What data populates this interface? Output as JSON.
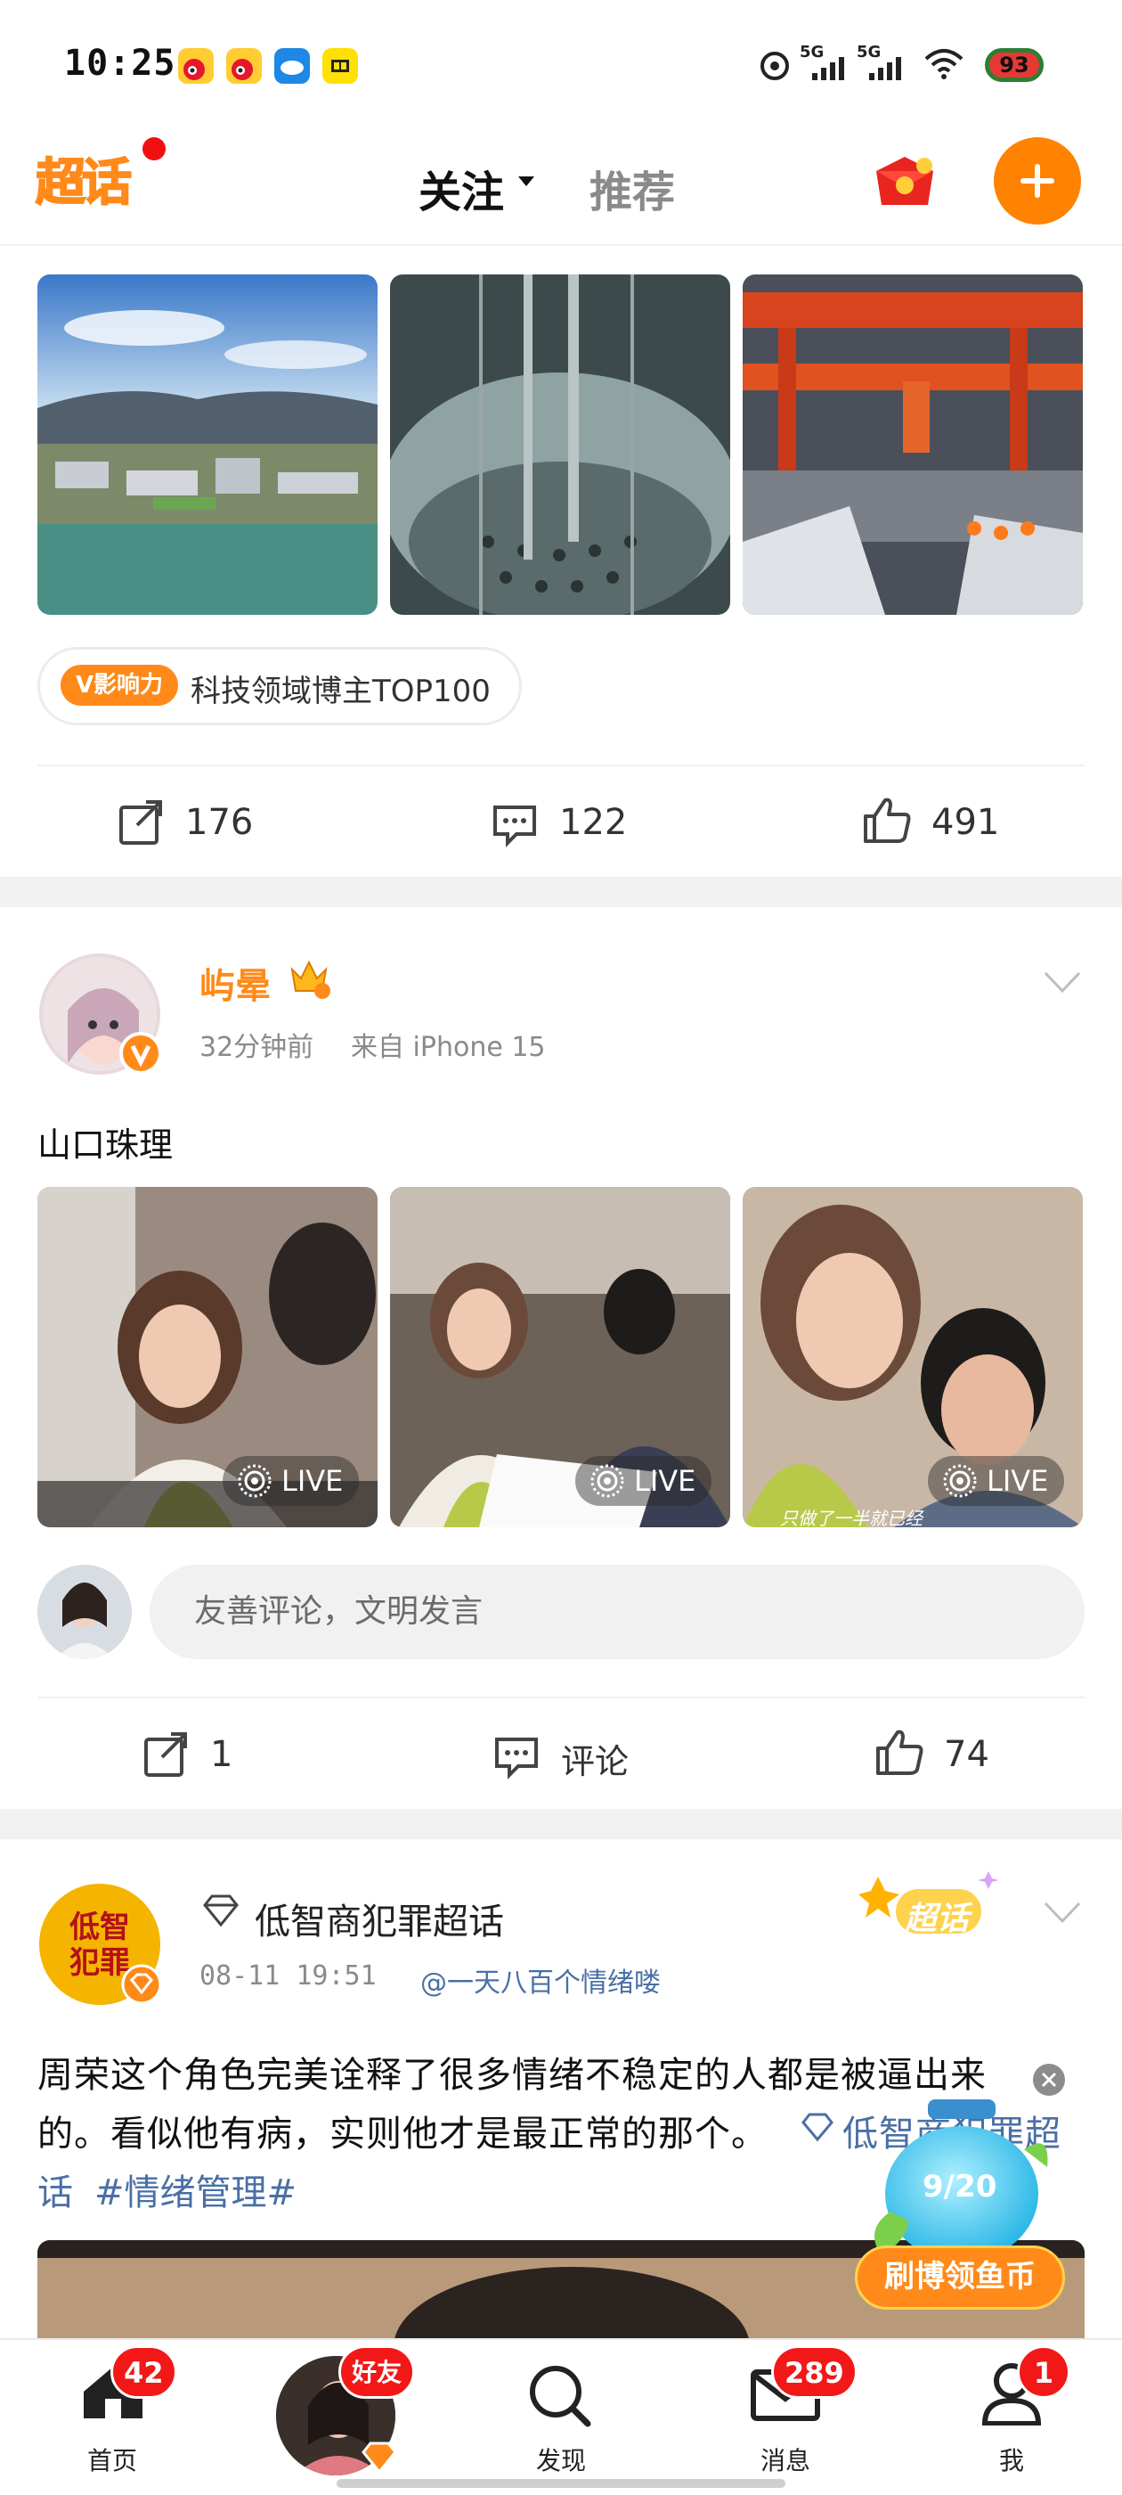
{
  "status_bar": {
    "time": "10:25",
    "signal1": "5G",
    "signal2": "5G",
    "battery": "93"
  },
  "header": {
    "logo": "超话",
    "tab_follow": "关注",
    "tab_recommend": "推荐"
  },
  "post1": {
    "influence_badge": "V影响力",
    "influence_text": "科技领域博主TOP100",
    "reposts": "176",
    "comments": "122",
    "likes": "491"
  },
  "post2": {
    "author": "屿晕",
    "time": "32分钟前",
    "source": "来自 iPhone 15",
    "text": "山口珠理",
    "live_label": "LIVE",
    "image_caption": "只做了一半就已经",
    "comment_placeholder": "友善评论，文明发言",
    "reposts": "1",
    "comments_label": "评论",
    "likes": "74"
  },
  "post3": {
    "author": "低智商犯罪超话",
    "avatar_text": "低智商犯罪",
    "datetime": "08-11 19:51",
    "mention": "@一天八百个情绪喽",
    "text_line1": "周荣这个角色完美诠释了很多情绪不稳定的人都是被逼出来",
    "text_line2": "的。看似他有病，实则他才是最正常的那个。",
    "topic_link": "低智商犯罪超",
    "topic_link_end": "话",
    "hashtag": "#情绪管理#",
    "super_badge": "超话"
  },
  "float_widget": {
    "progress": "9/20",
    "label": "刷博领鱼币"
  },
  "bottom_nav": {
    "home": "首页",
    "home_badge": "42",
    "friends_badge": "好友",
    "discover": "发现",
    "messages": "消息",
    "messages_badge": "289",
    "me": "我",
    "me_badge": "1"
  }
}
